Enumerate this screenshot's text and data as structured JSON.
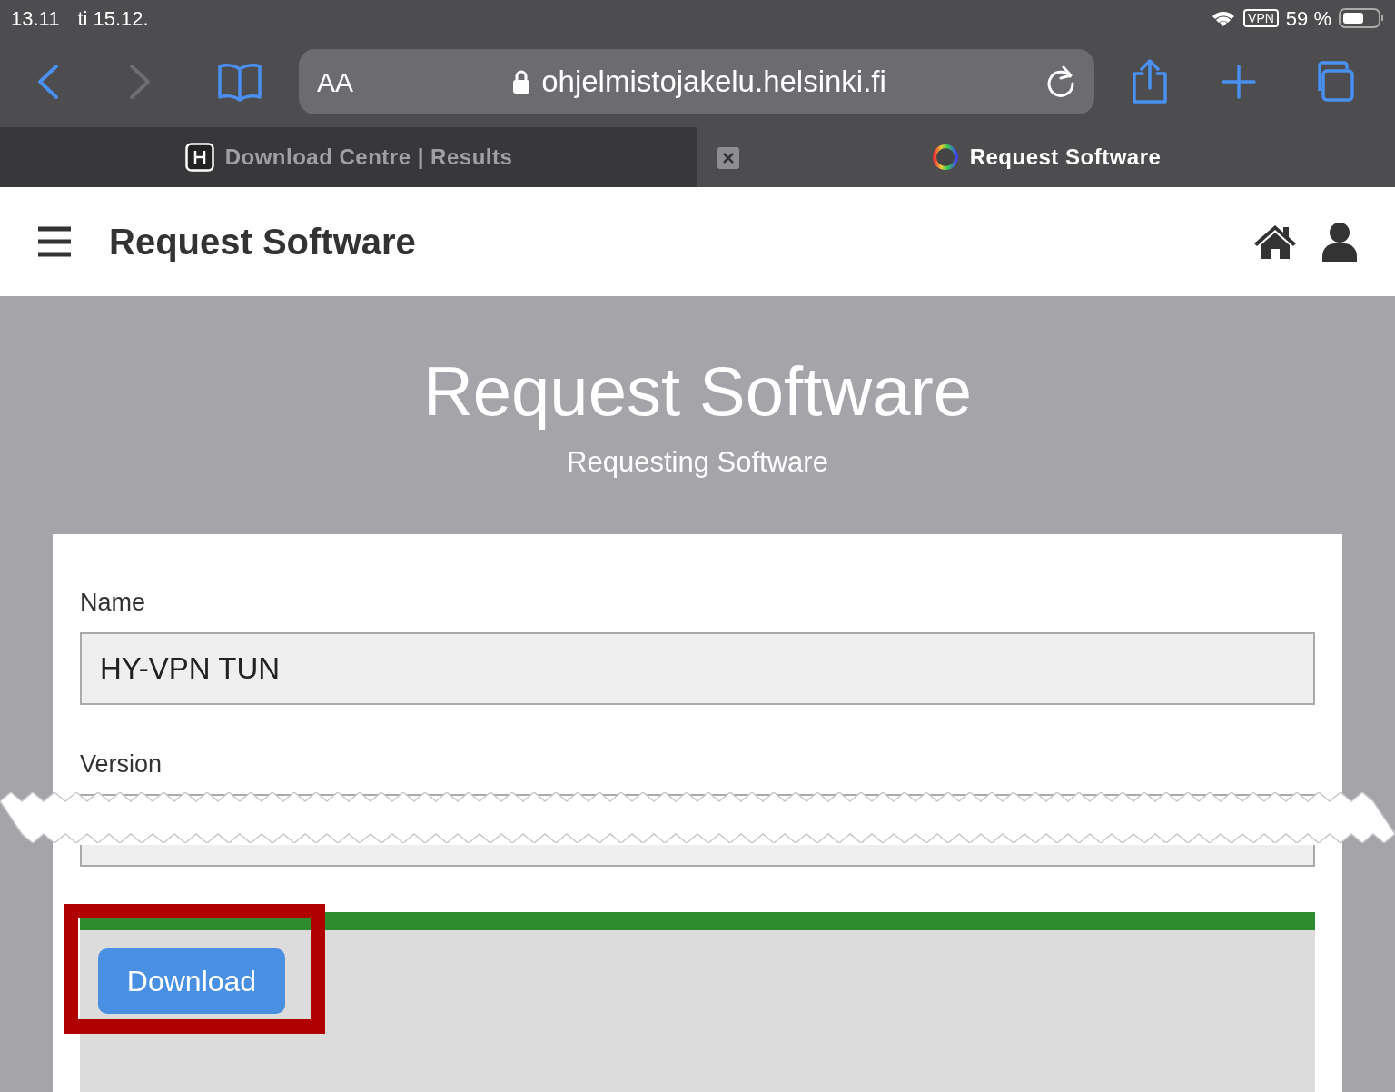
{
  "status_bar": {
    "time": "13.11",
    "date": "ti 15.12.",
    "vpn": "VPN",
    "battery": "59 %"
  },
  "toolbar": {
    "text_size": "AA",
    "url": "ohjelmistojakelu.helsinki.fi"
  },
  "tabs": [
    {
      "label": "Download Centre | Results",
      "selected": false
    },
    {
      "label": "Request Software",
      "selected": true
    }
  ],
  "header": {
    "title": "Request Software"
  },
  "hero": {
    "title": "Request Software",
    "subtitle": "Requesting Software"
  },
  "fields": [
    {
      "label": "Name",
      "value": "HY-VPN TUN"
    },
    {
      "label": "Version"
    }
  ],
  "download_button": "Download"
}
